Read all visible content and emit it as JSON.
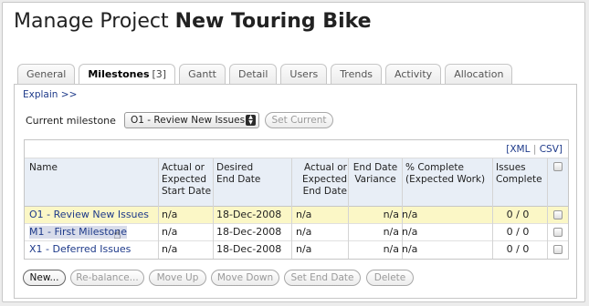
{
  "page": {
    "title_prefix": "Manage Project",
    "project_name": "New Touring Bike"
  },
  "tabs": [
    {
      "label": "General"
    },
    {
      "label": "Milestones",
      "count": "[3]",
      "active": true
    },
    {
      "label": "Gantt"
    },
    {
      "label": "Detail"
    },
    {
      "label": "Users"
    },
    {
      "label": "Trends"
    },
    {
      "label": "Activity"
    },
    {
      "label": "Allocation"
    }
  ],
  "panel": {
    "explain_link": "Explain >>",
    "current_milestone_label": "Current milestone",
    "current_milestone_value": "O1 - Review New Issues",
    "set_current_button": "Set Current"
  },
  "export": {
    "xml": "XML",
    "separator": "|",
    "csv": "CSV"
  },
  "table": {
    "headers": {
      "name": "Name",
      "actual_start": "Actual or\nExpected\nStart Date",
      "desired_end": "Desired\nEnd Date",
      "actual_end": "Actual or\nExpected\nEnd Date",
      "variance": "End Date\nVariance",
      "pct": "% Complete\n(Expected Work)",
      "issues": "Issues\nComplete"
    },
    "rows": [
      {
        "name": "O1 - Review New Issues",
        "start": "n/a",
        "desired_end": "18-Dec-2008",
        "actual_end": "n/a",
        "variance": "n/a",
        "pct": "n/a",
        "issues": "0 / 0",
        "selected": true
      },
      {
        "name": "M1 - First Milestone",
        "start": "n/a",
        "desired_end": "18-Dec-2008",
        "actual_end": "n/a",
        "variance": "n/a",
        "pct": "n/a",
        "issues": "0 / 0",
        "selected": false
      },
      {
        "name": "X1 - Deferred Issues",
        "start": "n/a",
        "desired_end": "18-Dec-2008",
        "actual_end": "n/a",
        "variance": "n/a",
        "pct": "n/a",
        "issues": "0 / 0",
        "selected": false
      }
    ]
  },
  "buttons": {
    "new": "New...",
    "rebalance": "Re-balance...",
    "move_up": "Move Up",
    "move_down": "Move Down",
    "set_end_date": "Set End Date",
    "delete": "Delete"
  },
  "colors": {
    "link": "#1e3a8a",
    "header_bg": "#e8eef6",
    "selected_row_bg": "#fbf7c6"
  },
  "icons": {
    "cursor": "hand-pointer-icon",
    "dropdown": "updown-arrows-icon"
  }
}
